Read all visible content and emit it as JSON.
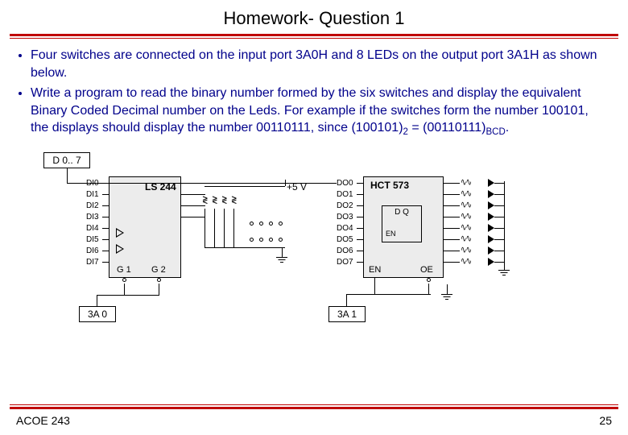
{
  "title": "Homework- Question 1",
  "bullets": {
    "b1": "Four switches are connected on the input port 3A0H and 8 LEDs on the output port 3A1H as shown below.",
    "b2_part1": "Write a program to read the binary number formed by the six switches and display the equivalent Binary Coded Decimal number on the Leds. For example if the switches form the number 100101, the displays should display the number 00110111, since (100101)",
    "b2_sub1": "2",
    "b2_mid": " = (00110111)",
    "b2_sub2": "BCD",
    "b2_end": "."
  },
  "diagram": {
    "bus_label": "D 0.. 7",
    "chip1": "LS 244",
    "chip2": "HCT 573",
    "voltage": "+5 V",
    "port1": "3A 0",
    "port2": "3A 1",
    "g1": "G 1",
    "g2": "G 2",
    "en": "EN",
    "oe": "OE",
    "dq": "D   Q",
    "chip2_en": "EN",
    "di": [
      "DI0",
      "DI1",
      "DI2",
      "DI3",
      "DI4",
      "DI5",
      "DI6",
      "DI7"
    ],
    "do": [
      "DO0",
      "DO1",
      "DO2",
      "DO3",
      "DO4",
      "DO5",
      "DO6",
      "DO7"
    ]
  },
  "footer": {
    "left": "ACOE 243",
    "right": "25"
  }
}
